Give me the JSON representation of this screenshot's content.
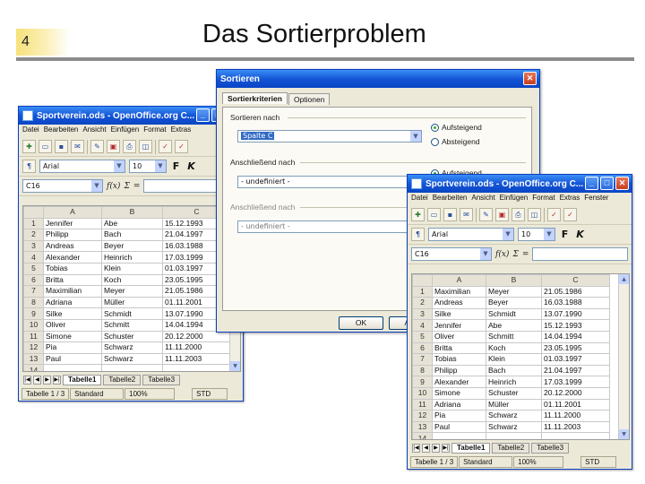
{
  "slide": {
    "number": "4",
    "title": "Das Sortierproblem"
  },
  "window_back": {
    "title": "Sportverein.ods - OpenOffice.org C...",
    "menu": [
      "Datei",
      "Bearbeiten",
      "Ansicht",
      "Einfügen",
      "Format",
      "Extras"
    ],
    "font_name": "Arial",
    "font_size": "10",
    "cell_ref": "C16",
    "columns": [
      "A",
      "B",
      "C"
    ],
    "rows": [
      [
        "1",
        "Jennifer",
        "Abe",
        "15.12.1993"
      ],
      [
        "2",
        "Philipp",
        "Bach",
        "21.04.1997"
      ],
      [
        "3",
        "Andreas",
        "Beyer",
        "16.03.1988"
      ],
      [
        "4",
        "Alexander",
        "Heinrich",
        "17.03.1999"
      ],
      [
        "5",
        "Tobias",
        "Klein",
        "01.03.1997"
      ],
      [
        "6",
        "Britta",
        "Koch",
        "23.05.1995"
      ],
      [
        "7",
        "Maximilian",
        "Meyer",
        "21.05.1986"
      ],
      [
        "8",
        "Adriana",
        "Müller",
        "01.11.2001"
      ],
      [
        "9",
        "Silke",
        "Schmidt",
        "13.07.1990"
      ],
      [
        "10",
        "Oliver",
        "Schmitt",
        "14.04.1994"
      ],
      [
        "11",
        "Simone",
        "Schuster",
        "20.12.2000"
      ],
      [
        "12",
        "Pia",
        "Schwarz",
        "11.11.2000"
      ],
      [
        "13",
        "Paul",
        "Schwarz",
        "11.11.2003"
      ],
      [
        "14",
        "",
        "",
        ""
      ]
    ],
    "sheets": [
      "Tabelle1",
      "Tabelle2",
      "Tabelle3"
    ],
    "status": [
      "Tabelle 1 / 3",
      "Standard",
      "100%",
      "STD"
    ]
  },
  "dialog": {
    "title": "Sortieren",
    "tabs": [
      "Sortierkriterien",
      "Optionen"
    ],
    "sort_by_label": "Sortieren nach",
    "sort_by_value": "Spalte C",
    "then_label_1": "Anschließend nach",
    "then_value_1": "- undefiniert -",
    "then_label_2": "Anschließend nach",
    "then_value_2": "- undefiniert -",
    "ascending": "Aufsteigend",
    "descending": "Absteigend",
    "ok": "OK",
    "cancel": "Abb"
  },
  "window_front": {
    "title": "Sportverein.ods - OpenOffice.org C...",
    "menu": [
      "Datei",
      "Bearbeiten",
      "Ansicht",
      "Einfügen",
      "Format",
      "Extras",
      "Fenster"
    ],
    "font_name": "Arial",
    "font_size": "10",
    "cell_ref": "C16",
    "columns": [
      "A",
      "B",
      "C"
    ],
    "rows": [
      [
        "1",
        "Maximilian",
        "Meyer",
        "21.05.1986"
      ],
      [
        "2",
        "Andreas",
        "Beyer",
        "16.03.1988"
      ],
      [
        "3",
        "Silke",
        "Schmidt",
        "13.07.1990"
      ],
      [
        "4",
        "Jennifer",
        "Abe",
        "15.12.1993"
      ],
      [
        "5",
        "Oliver",
        "Schmitt",
        "14.04.1994"
      ],
      [
        "6",
        "Britta",
        "Koch",
        "23.05.1995"
      ],
      [
        "7",
        "Tobias",
        "Klein",
        "01.03.1997"
      ],
      [
        "8",
        "Philipp",
        "Bach",
        "21.04.1997"
      ],
      [
        "9",
        "Alexander",
        "Heinrich",
        "17.03.1999"
      ],
      [
        "10",
        "Simone",
        "Schuster",
        "20.12.2000"
      ],
      [
        "11",
        "Adriana",
        "Müller",
        "01.11.2001"
      ],
      [
        "12",
        "Pia",
        "Schwarz",
        "11.11.2000"
      ],
      [
        "13",
        "Paul",
        "Schwarz",
        "11.11.2003"
      ],
      [
        "14",
        "",
        "",
        ""
      ]
    ],
    "sheets": [
      "Tabelle1",
      "Tabelle2",
      "Tabelle3"
    ],
    "status": [
      "Tabelle 1 / 3",
      "Standard",
      "100%",
      "STD"
    ]
  }
}
